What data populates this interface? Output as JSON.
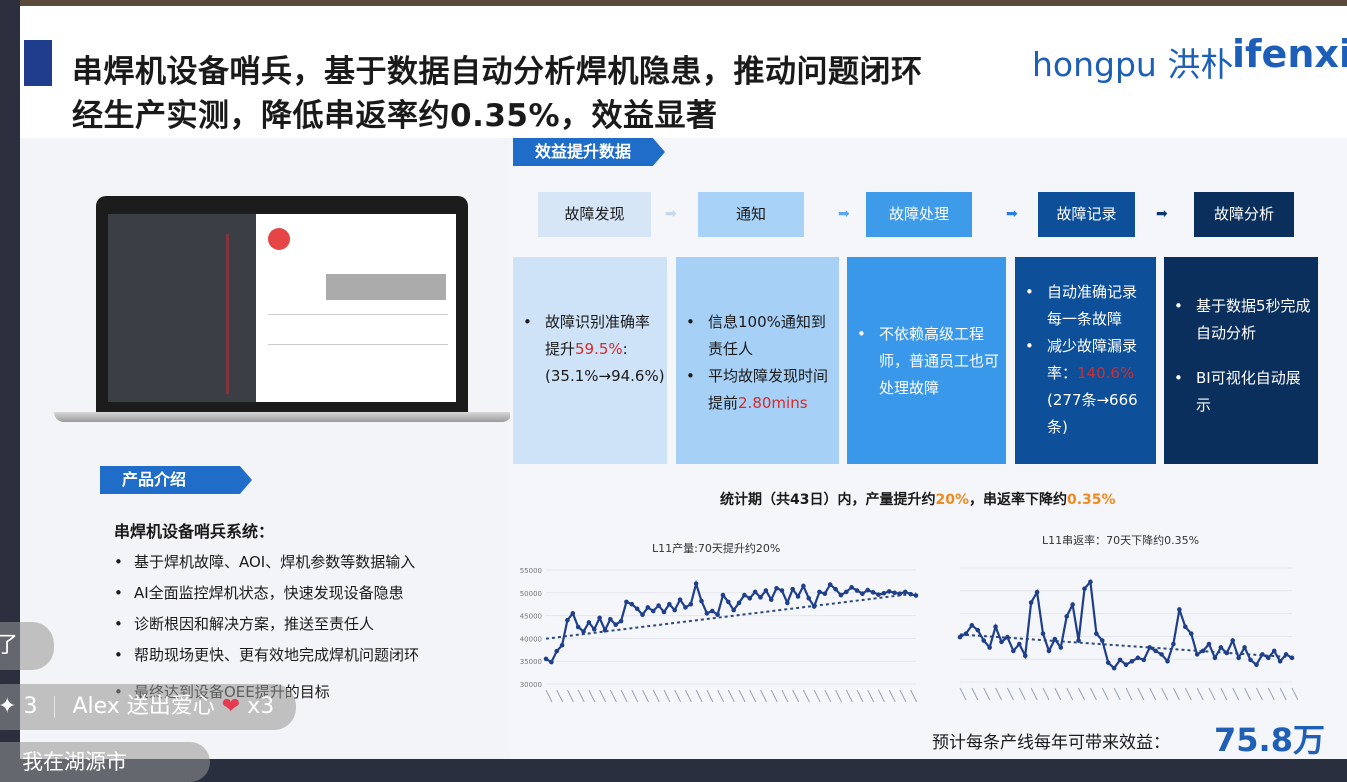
{
  "slide": {
    "title_line1": "串焊机设备哨兵，基于数据自动分析焊机隐患，推动问题闭环",
    "title_line2": "经生产实测，降低串返率约0.35%，效益显著",
    "logo_hongpu": "hongpu 洪朴",
    "logo_ifenxi": "ifenxi"
  },
  "product": {
    "ribbon": "产品介绍",
    "heading": "串焊机设备哨兵系统：",
    "bullets": [
      "基于焊机故障、AOI、焊机参数等数据输入",
      "AI全面监控焊机状态，快速发现设备隐患",
      "诊断根因和解决方案，推送至责任人",
      "帮助现场更快、更有效地完成焊机问题闭环",
      "最终达到设备OEE提升的目标"
    ]
  },
  "benefit": {
    "ribbon": "效益提升数据",
    "steps": [
      "故障发现",
      "通知",
      "故障处理",
      "故障记录",
      "故障分析"
    ],
    "col1": {
      "pre": "故障识别准确率提升",
      "val": "59.5%",
      "post": ":(35.1%→94.6%)"
    },
    "col2": {
      "b1": "信息100%通知到责任人",
      "b2_pre": "平均故障发现时间提前",
      "b2_val": "2.80mins"
    },
    "col3": {
      "b1": "不依赖高级工程师，普通员工也可处理故障"
    },
    "col4": {
      "b1": "自动准确记录每一条故障",
      "b2_pre": "减少故障漏录率：",
      "b2_val": "140.6%",
      "b2_post": "(277条→666条)"
    },
    "col5": {
      "b1": "基于数据5秒完成自动分析",
      "b2": "BI可视化自动展示"
    },
    "stats": {
      "pre": "统计期（共43日）内，产量提升约",
      "val1": "20%",
      "mid": "，串返率下降约",
      "val2": "0.35%"
    },
    "footer_label": "预计每条产线每年可带来效益：",
    "footer_value": "75.8万"
  },
  "chart_data": [
    {
      "type": "line",
      "title": "L11产量:70天提升约20%",
      "ylim": [
        30000,
        55000
      ],
      "y_ticks": [
        "30000",
        "35000",
        "40000",
        "45000",
        "50000",
        "55000"
      ],
      "series": [
        {
          "values": [
            35500,
            34800,
            37200,
            38500,
            44000,
            45500,
            42500,
            41500,
            43500,
            42000,
            44500,
            41800,
            44200,
            43000,
            43800,
            48000,
            47500,
            46500,
            45200,
            46800,
            46000,
            47200,
            45800,
            47500,
            46200,
            48500,
            46800,
            47500,
            52000,
            48200,
            45500,
            46000,
            45200,
            49500,
            48000,
            46200,
            47800,
            49500,
            48800,
            50200,
            49000,
            50500,
            48500,
            51000,
            50500,
            47800,
            50800,
            49200,
            51500,
            48800,
            47000,
            50200,
            49800,
            51800,
            50800,
            49500,
            50200,
            51200,
            50500,
            49800,
            50600,
            50100,
            49600,
            49900,
            50300,
            50000,
            49800,
            50200,
            49700,
            49400
          ]
        }
      ]
    },
    {
      "type": "line",
      "title": "L11串返率：70天下降约0.35%",
      "series": [
        {
          "values": [
            1.45,
            1.5,
            1.62,
            1.55,
            1.4,
            1.3,
            1.6,
            1.38,
            1.45,
            1.25,
            1.35,
            1.18,
            1.95,
            2.1,
            1.5,
            1.25,
            1.42,
            1.3,
            1.75,
            1.92,
            1.4,
            2.15,
            2.25,
            1.5,
            1.4,
            1.08,
            1.0,
            1.12,
            1.05,
            1.1,
            1.15,
            1.12,
            1.3,
            1.25,
            1.2,
            1.1,
            1.35,
            1.85,
            1.6,
            1.5,
            1.2,
            1.25,
            1.35,
            1.15,
            1.3,
            1.22,
            1.4,
            1.15,
            1.3,
            1.12,
            1.05,
            1.2,
            1.15,
            1.25,
            1.1,
            1.2,
            1.15
          ]
        }
      ]
    }
  ],
  "overlay": {
    "bubble1": "了",
    "bubble2_count": "3",
    "bubble2_text": "Alex 送出爱心",
    "bubble2_heart": "❤",
    "bubble2_mult": "x3",
    "bubble3": "我在湖源市"
  }
}
